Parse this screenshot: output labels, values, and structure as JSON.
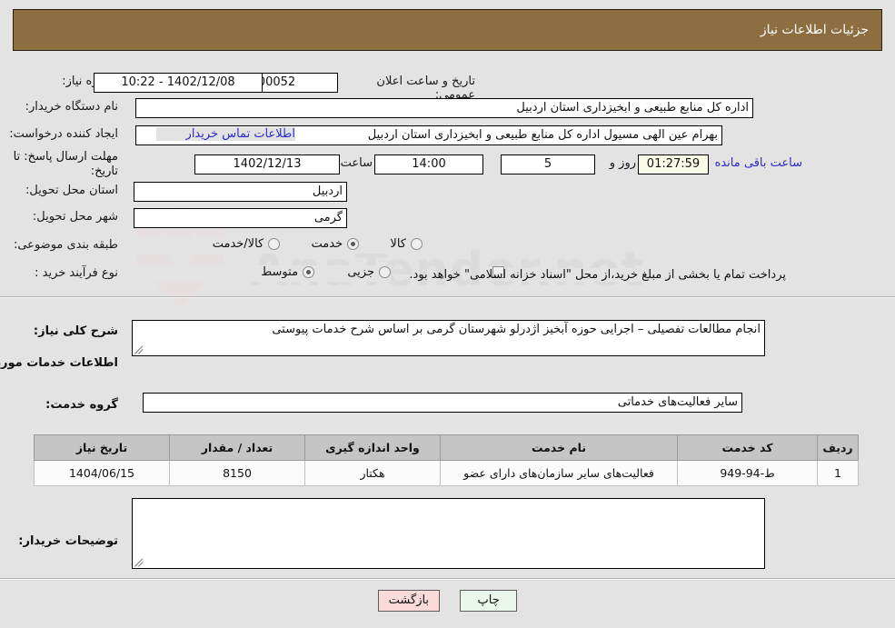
{
  "header": {
    "title": "جزئیات اطلاعات نیاز"
  },
  "watermark": {
    "text": "AnaTender.net"
  },
  "form": {
    "need_number_label": "شماره نیاز:",
    "need_number_value": "1102003847000052",
    "public_announce_label": "تاریخ و ساعت اعلان عمومی:",
    "public_announce_value": "1402/12/08 - 10:22",
    "buyer_org_label": "نام دستگاه خریدار:",
    "buyer_org_value": "اداره کل منابع طبیعی و ابخیزداری استان اردبیل",
    "requester_label": "ایجاد کننده درخواست:",
    "requester_value": "بهرام عین الهی مسیول اداره کل منابع طبیعی و ابخیزداری استان اردبیل",
    "contact_link": "اطلاعات تماس خریدار",
    "deadline_label": "مهلت ارسال پاسخ: تا تاریخ:",
    "deadline_date": "1402/12/13",
    "hour_label": "ساعت",
    "deadline_time": "14:00",
    "days_value": "5",
    "days_label": "روز و",
    "countdown_value": "01:27:59",
    "countdown_label": "ساعت باقی مانده",
    "province_label": "استان محل تحویل:",
    "province_value": "اردبیل",
    "city_label": "شهر محل تحویل:",
    "city_value": "گرمی",
    "classification_label": "طبقه بندی موضوعی:",
    "classification_options": [
      {
        "label": "کالا",
        "selected": false
      },
      {
        "label": "خدمت",
        "selected": true
      },
      {
        "label": "کالا/خدمت",
        "selected": false
      }
    ],
    "purchase_type_label": "نوع فرآیند خرید :",
    "purchase_type_options": [
      {
        "label": "جزیی",
        "selected": false
      },
      {
        "label": "متوسط",
        "selected": true
      }
    ],
    "treasury_checkbox_checked": false,
    "treasury_note": "پرداخت تمام یا بخشی از مبلغ خرید،از محل \"اسناد خزانه اسلامی\" خواهد بود."
  },
  "summary": {
    "label": "شرح کلی نیاز:",
    "value": "انجام مطالعات تفصیلی – اجرایی حوزه آبخیز اژدرلو شهرستان گرمی بر اساس شرح خدمات پیوستی"
  },
  "services_section": {
    "heading": "اطلاعات خدمات مورد نیاز",
    "group_label": "گروه خدمت:",
    "group_value": "سایر فعالیت‌های خدماتی"
  },
  "table": {
    "columns": [
      "ردیف",
      "کد خدمت",
      "نام خدمت",
      "واحد اندازه گیری",
      "تعداد / مقدار",
      "تاریخ نیاز"
    ],
    "rows": [
      {
        "row": "1",
        "code": "ط-94-949",
        "name": "فعالیت‌های سایر سازمان‌های دارای عضو",
        "unit": "هکتار",
        "quantity": "8150",
        "need_date": "1404/06/15"
      }
    ]
  },
  "buyer_notes": {
    "label": "توضیحات خریدار:",
    "value": ""
  },
  "footer": {
    "print_label": "چاپ",
    "back_label": "بازگشت"
  },
  "colors": {
    "header_brown": "#8d6e41",
    "page_bg": "#e3e3e3",
    "link_blue": "#2b2bd0",
    "timer_bg": "#fbfbe8",
    "print_btn": "#eaf7ea",
    "back_btn": "#fbdada",
    "table_header": "#c5c5c5"
  }
}
